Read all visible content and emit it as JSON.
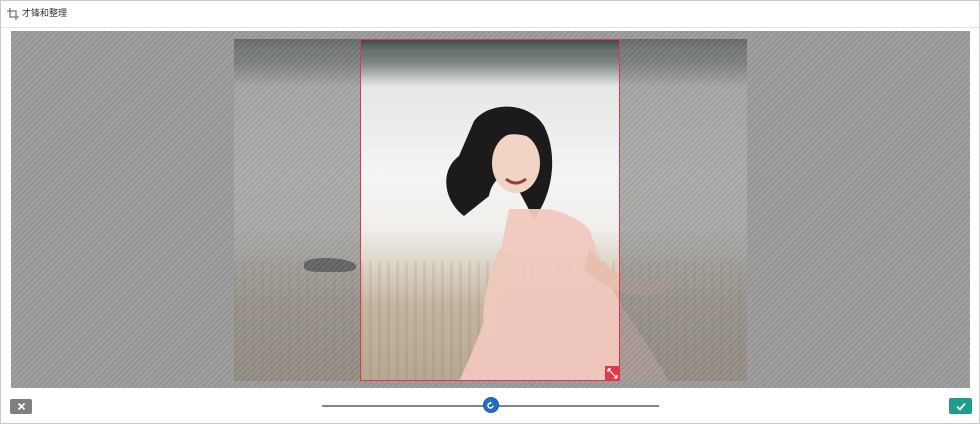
{
  "window": {
    "title": "才锋和整理",
    "title_icon": "crop-icon"
  },
  "editor": {
    "photo_subject": "girl-on-beach-photo",
    "resize_handle_icon": "resize-diagonal-icon"
  },
  "footer": {
    "cancel_icon": "close-icon",
    "confirm_icon": "checkmark-icon",
    "zoom_slider": {
      "value": 0.5,
      "thumb_icon": "rotate-icon"
    }
  },
  "colors": {
    "crop_accent": "#e0394e",
    "confirm": "#1e9c8c",
    "cancel": "#7f7f7f",
    "slider_thumb": "#1f6fc4"
  }
}
